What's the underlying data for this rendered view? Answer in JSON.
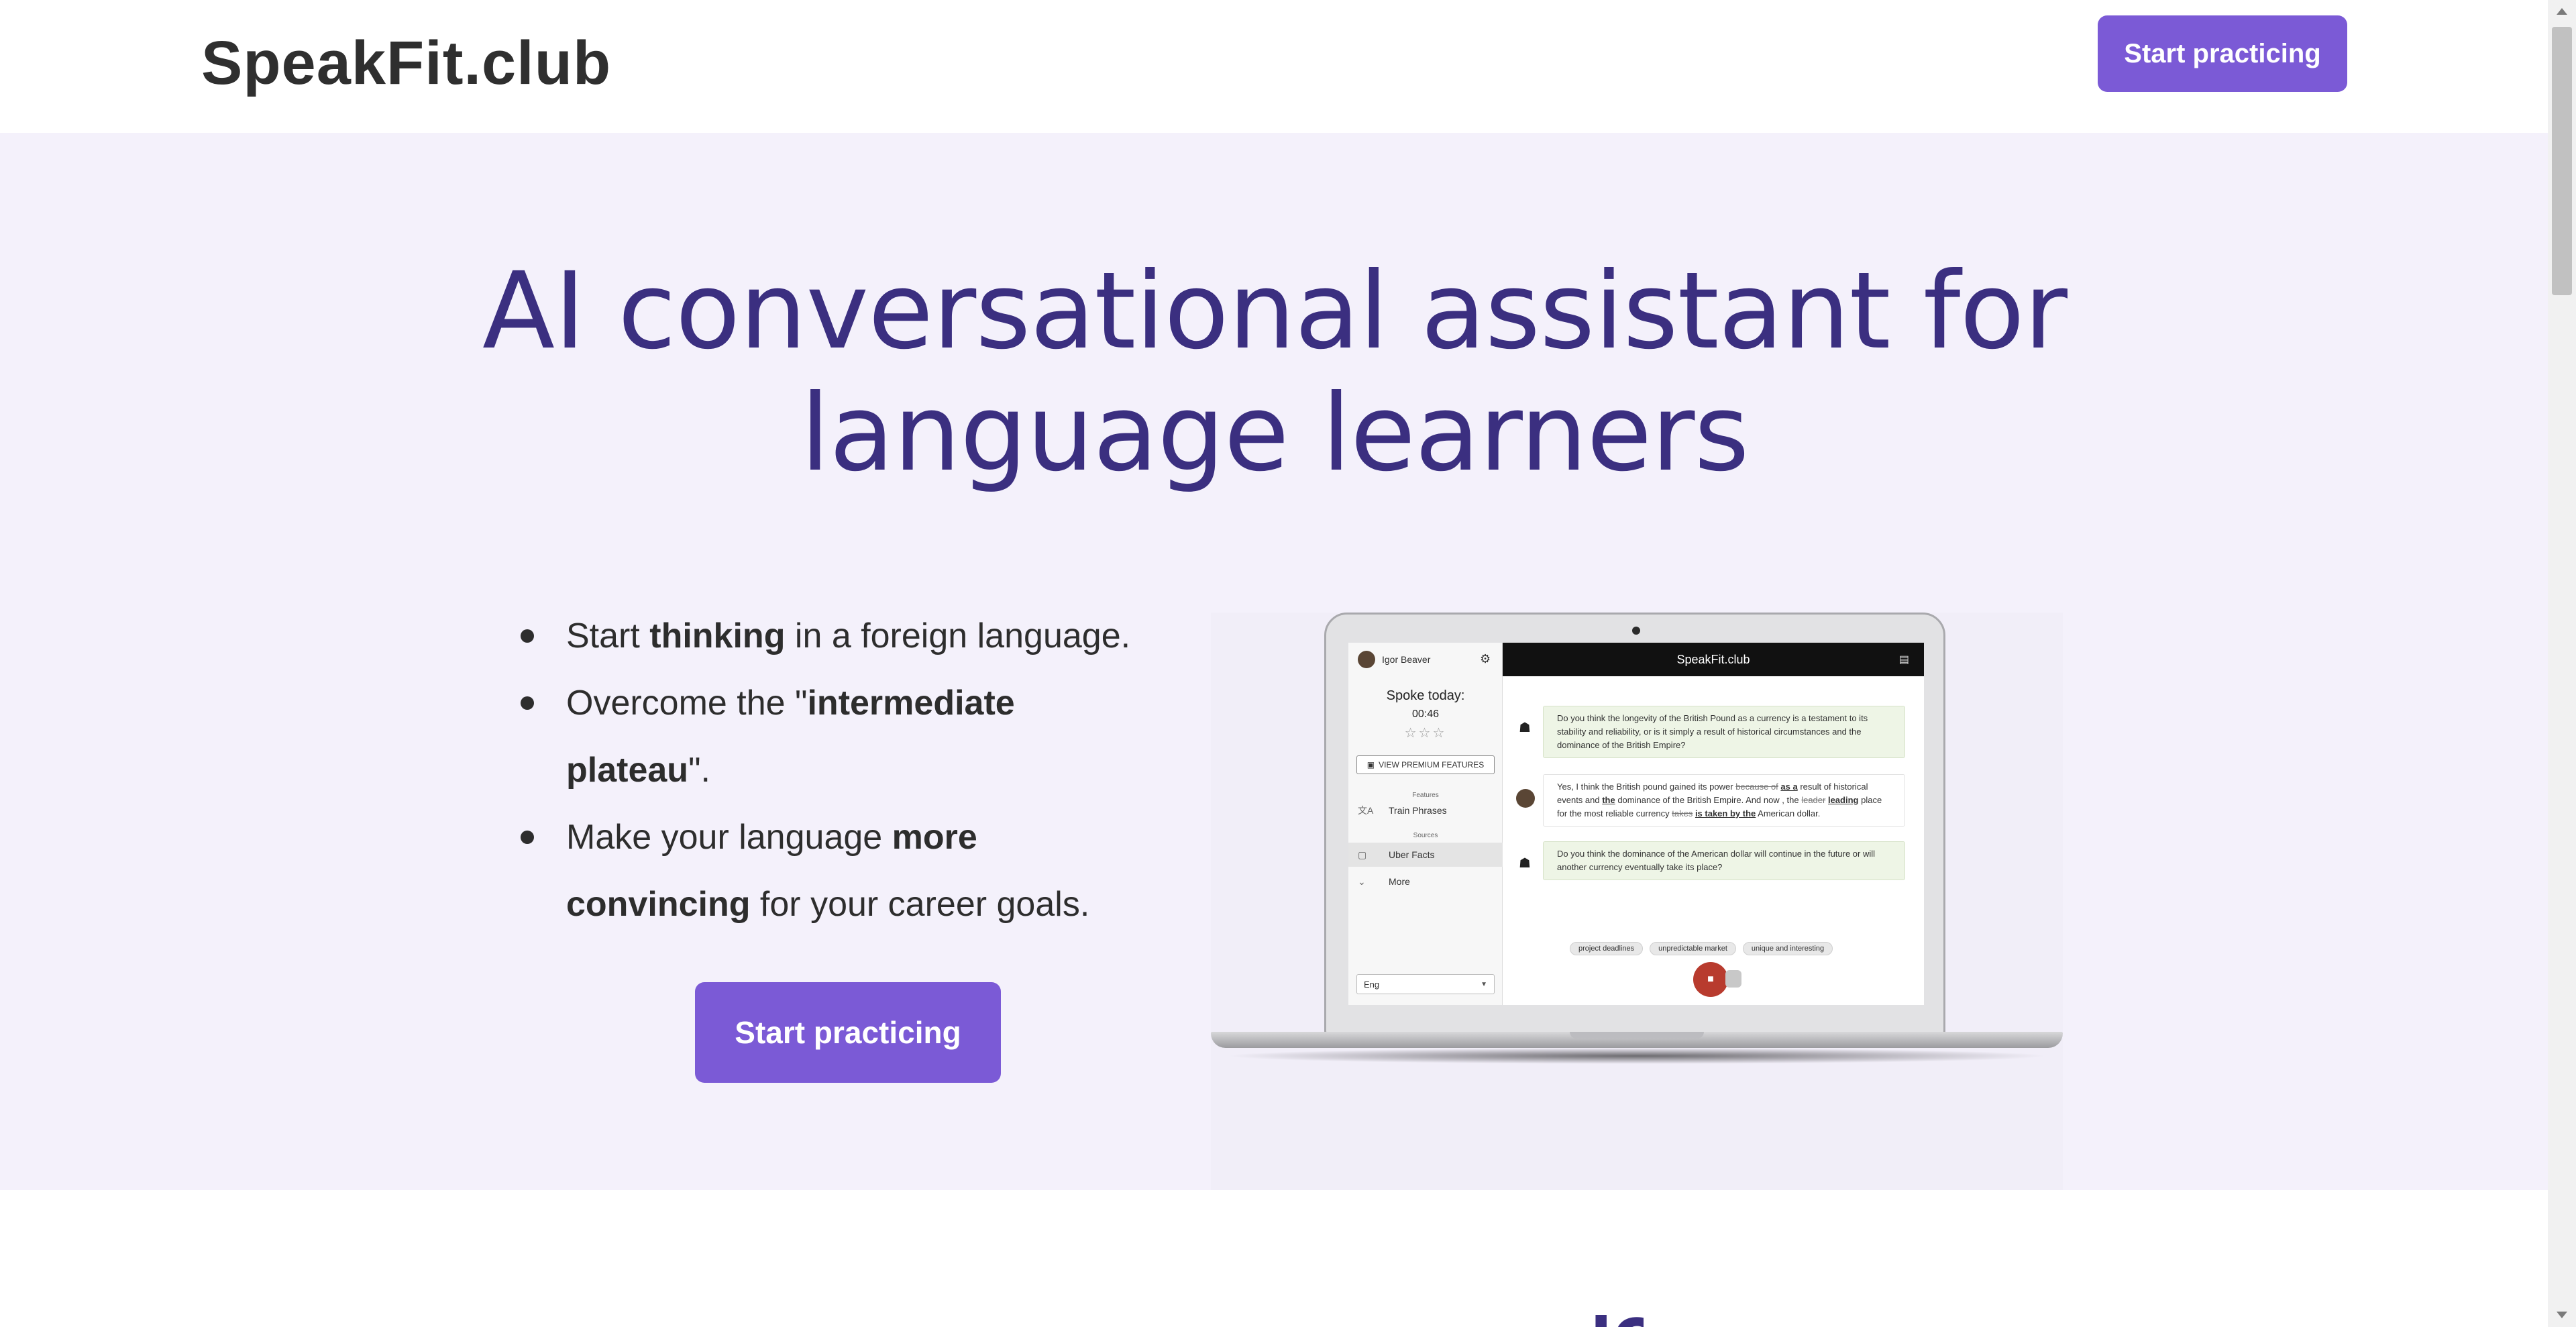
{
  "header": {
    "brand": "SpeakFit.club",
    "cta_label": "Start practicing"
  },
  "hero": {
    "title": "AI conversational assistant for language learners",
    "bullets": [
      {
        "before": "Start ",
        "bold": "thinking",
        "after": " in a foreign language."
      },
      {
        "before": "Overcome the \"",
        "bold": "intermediate plateau",
        "after": "\"."
      },
      {
        "before": "Make your language ",
        "bold": "more convincing",
        "after": " for your career goals."
      }
    ],
    "cta_label": "Start practicing"
  },
  "app_preview": {
    "user_name": "Igor Beaver",
    "spoke_today_label": "Spoke today:",
    "timer": "00:46",
    "stars": "☆☆☆",
    "premium_label": "VIEW PREMIUM FEATURES",
    "features_section": "Features",
    "train_phrases": "Train Phrases",
    "sources_section": "Sources",
    "uber_facts": "Uber Facts",
    "more": "More",
    "language": "Eng",
    "app_title": "SpeakFit.club",
    "messages": {
      "bot1": "Do you think the longevity of the British Pound as a currency is a testament to its stability and reliability, or is it simply a result of historical circumstances and the dominance of the British Empire?",
      "user_a": "Yes, I think the British pound gained its power ",
      "user_strike1": "because of",
      "user_fix1": "as a",
      "user_b": " result of historical events and ",
      "user_fix2": "the",
      "user_c": " dominance of the British Empire. And now , the ",
      "user_strike2": "leader",
      "user_fix3": "leading",
      "user_d": " place for the most reliable currency ",
      "user_strike3": "takes",
      "user_fix4": "is taken by the",
      "user_e": " American dollar.",
      "bot2": "Do you think the dominance of the American dollar will continue in the future or will another currency eventually take its place?"
    },
    "chips": [
      "project deadlines",
      "unpredictable market",
      "unique and interesting"
    ]
  },
  "colors": {
    "accent": "#7b5ad6",
    "title": "#3b2f80",
    "hero_bg": "#f4f1fb"
  }
}
